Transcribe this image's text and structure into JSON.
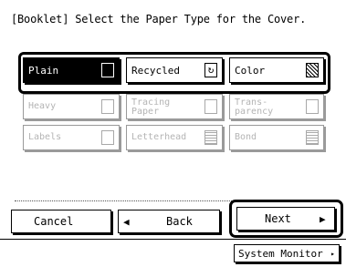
{
  "title": "[Booklet] Select the Paper Type for the Cover.",
  "paper_types": [
    {
      "label": "Plain",
      "icon": "plain-paper-icon",
      "state": "selected"
    },
    {
      "label": "Recycled",
      "icon": "recycled-paper-icon",
      "icon_glyph": "↻",
      "state": "enabled"
    },
    {
      "label": "Color",
      "icon": "color-paper-icon",
      "state": "enabled"
    },
    {
      "label": "Heavy",
      "icon": "heavy-paper-icon",
      "state": "disabled"
    },
    {
      "label_line1": "Tracing",
      "label_line2": "Paper",
      "icon": "tracing-paper-icon",
      "state": "disabled"
    },
    {
      "label_line1": "Trans-",
      "label_line2": "parency",
      "icon": "transparency-icon",
      "state": "disabled"
    },
    {
      "label": "Labels",
      "icon": "labels-icon",
      "state": "disabled"
    },
    {
      "label": "Letterhead",
      "icon": "letterhead-icon",
      "state": "disabled"
    },
    {
      "label": "Bond",
      "icon": "bond-paper-icon",
      "state": "disabled"
    }
  ],
  "buttons": {
    "cancel": "Cancel",
    "back": "Back",
    "back_icon": "◀",
    "next": "Next",
    "next_icon": "▶"
  },
  "footer": {
    "system_monitor": "System Monitor",
    "system_monitor_icon": "▸"
  }
}
